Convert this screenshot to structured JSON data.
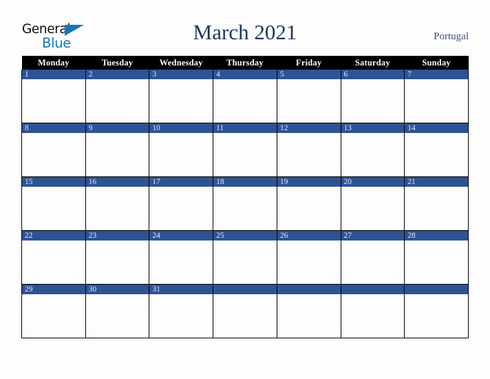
{
  "logo": {
    "word_top": "General",
    "word_bottom": "Blue",
    "triangle_icon": "triangle-icon",
    "accent_color": "#1577bd",
    "text_color": "#0d0d0d"
  },
  "header": {
    "title": "March 2021",
    "location": "Portugal",
    "title_color": "#20365e",
    "location_color": "#384f77"
  },
  "calendar": {
    "month": "March",
    "year": "2021",
    "header_bg": "#000000",
    "header_text_color": "#ffffff",
    "daynum_band_color": "#2e5395",
    "daynum_text_color": "#e8eaf2",
    "cell_bg": "#fdfdfd",
    "grid_line_color": "#000000",
    "weekday_headers": [
      "Monday",
      "Tuesday",
      "Wednesday",
      "Thursday",
      "Friday",
      "Saturday",
      "Sunday"
    ],
    "weeks": [
      [
        "1",
        "2",
        "3",
        "4",
        "5",
        "6",
        "7"
      ],
      [
        "8",
        "9",
        "10",
        "11",
        "12",
        "13",
        "14"
      ],
      [
        "15",
        "16",
        "17",
        "18",
        "19",
        "20",
        "21"
      ],
      [
        "22",
        "23",
        "24",
        "25",
        "26",
        "27",
        "28"
      ],
      [
        "29",
        "30",
        "31",
        "",
        "",
        "",
        ""
      ]
    ]
  }
}
